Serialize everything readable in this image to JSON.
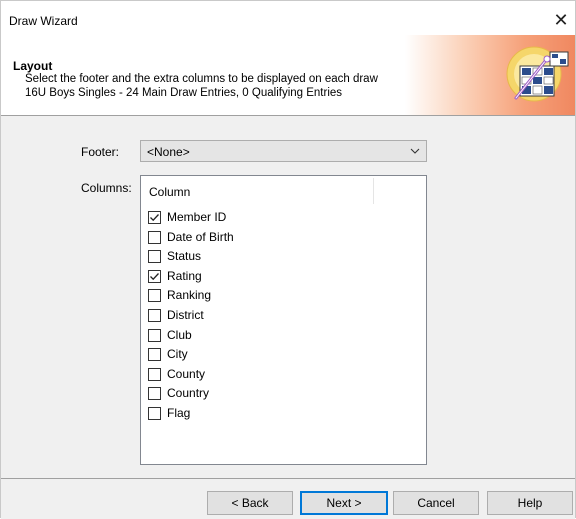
{
  "window": {
    "title": "Draw Wizard",
    "close_symbol": "✕"
  },
  "header": {
    "title": "Layout",
    "line1": "Select the footer and the extra columns to be displayed on each draw",
    "line2": "16U Boys Singles - 24 Main Draw Entries, 0 Qualifying Entries",
    "icon": "wizard-icon"
  },
  "footer_field": {
    "label": "Footer:",
    "value": "<None>"
  },
  "columns_field": {
    "label": "Columns:",
    "header": "Column",
    "items": [
      {
        "label": "Member ID",
        "checked": true
      },
      {
        "label": "Date of Birth",
        "checked": false
      },
      {
        "label": "Status",
        "checked": false
      },
      {
        "label": "Rating",
        "checked": true
      },
      {
        "label": "Ranking",
        "checked": false
      },
      {
        "label": "District",
        "checked": false
      },
      {
        "label": "Club",
        "checked": false
      },
      {
        "label": "City",
        "checked": false
      },
      {
        "label": "County",
        "checked": false
      },
      {
        "label": "Country",
        "checked": false
      },
      {
        "label": "Flag",
        "checked": false
      }
    ]
  },
  "buttons": {
    "back": "< Back",
    "next": "Next >",
    "cancel": "Cancel",
    "help": "Help"
  },
  "colors": {
    "accent": "#0078d7",
    "header_gradient": "#f08860",
    "dialog_bg": "#f0f0f0"
  }
}
